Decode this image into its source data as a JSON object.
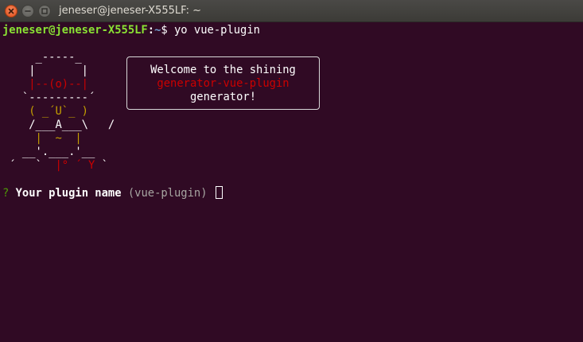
{
  "window": {
    "title": "jeneser@jeneser-X555LF: ~"
  },
  "command": {
    "user_host": "jeneser@jeneser-X555LF",
    "separator": ":",
    "path": "~",
    "symbol": "$",
    "text": " yo vue-plugin"
  },
  "ascii_art": {
    "l1": "     _-----_",
    "l2": "    |       |",
    "l3a": "    ",
    "l3b": "|--(o)--|",
    "l4": "   `---------´",
    "l5": "    ( _´U`_ )",
    "l6": "    /___A___\\   /",
    "l7": "     |  ~  |",
    "l8": "   __'.___.'__",
    "l9a": " ´   ` ",
    "l9b": " |° ",
    "l9c": "´ Y ",
    "l9d": "` "
  },
  "welcome": {
    "line1": "Welcome to the shining",
    "line2": "generator-vue-plugin",
    "line3": "generator!"
  },
  "question": {
    "marker": "?",
    "label": "Your plugin name",
    "default": "(vue-plugin)"
  },
  "colors": {
    "background": "#300a24",
    "prompt_user": "#8ae234",
    "prompt_path": "#729fcf",
    "art_yellow": "#c4a000",
    "art_red": "#cc0000"
  },
  "icons": {
    "close": "close-icon",
    "minimize": "minimize-icon",
    "maximize": "maximize-icon"
  }
}
